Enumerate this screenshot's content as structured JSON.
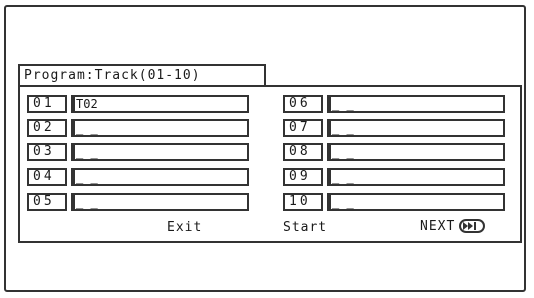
{
  "program": {
    "title": "Program:Track(01-10)",
    "tracks": [
      {
        "num": "01",
        "value": "T02"
      },
      {
        "num": "02",
        "value": "_ _"
      },
      {
        "num": "03",
        "value": "_ _"
      },
      {
        "num": "04",
        "value": "_ _"
      },
      {
        "num": "05",
        "value": "_ _"
      },
      {
        "num": "06",
        "value": "_ _"
      },
      {
        "num": "07",
        "value": "_ _"
      },
      {
        "num": "08",
        "value": "_ _"
      },
      {
        "num": "09",
        "value": "_ _"
      },
      {
        "num": "10",
        "value": "_ _"
      }
    ]
  },
  "footer": {
    "exit_label": "Exit",
    "start_label": "Start",
    "next_label": "NEXT",
    "next_icon": "skip-next-icon"
  }
}
